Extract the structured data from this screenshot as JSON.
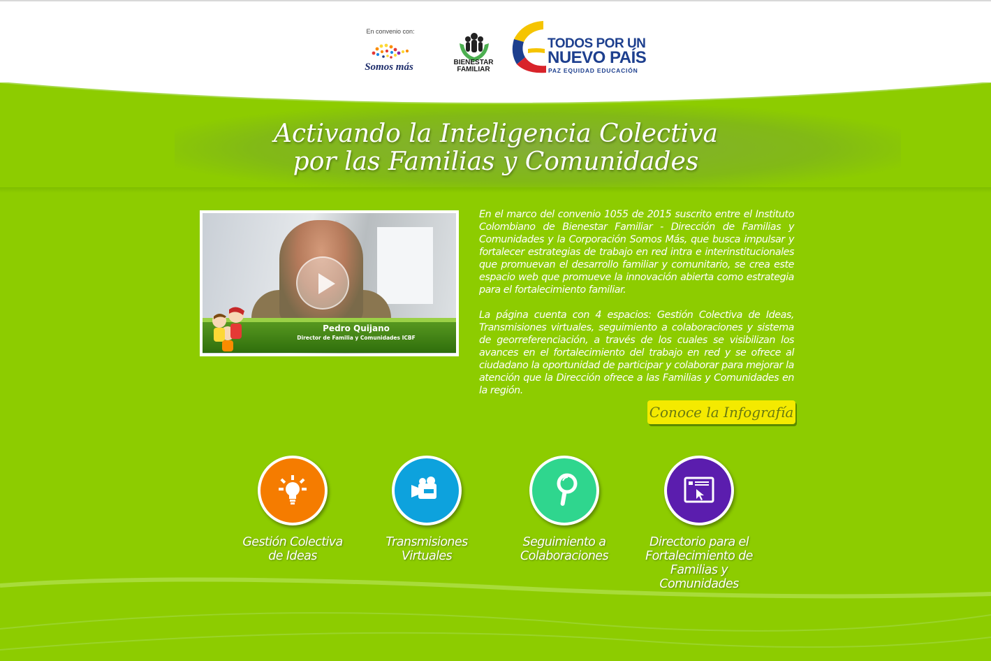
{
  "header": {
    "convenio_label": "En convenio con:",
    "somos_mas_logo": "Somos más",
    "bienestar_logo_line1": "BIENESTAR",
    "bienestar_logo_line2": "FAMILIAR",
    "tpu_line1": "TODOS POR UN",
    "tpu_line2": "NUEVO PAÍS",
    "tpu_tagline": "PAZ   EQUIDAD   EDUCACIÓN"
  },
  "hero": {
    "title_line1": "Activando la Inteligencia Colectiva",
    "title_line2": "por las Familias y Comunidades"
  },
  "video": {
    "speaker_name": "Pedro Quijano",
    "speaker_role": "Director de Familia y Comunidades ICBF",
    "play_icon": "play-icon"
  },
  "intro": {
    "paragraph1": "En el marco del convenio 1055 de 2015 suscrito entre el Instituto Colombiano de Bienestar Familiar - Dirección de Familias y Comunidades y la Corporación Somos Más, que busca impulsar y fortalecer estrategias de trabajo en red intra e interinstitucionales que promuevan el desarrollo familiar y comunitario, se crea este espacio web que promueve la innovación abierta como estrategia para el fortalecimiento familiar.",
    "paragraph2": "La página cuenta con 4 espacios: Gestión Colectiva de Ideas, Transmisiones virtuales, seguimiento a colaboraciones y sistema de georreferenciación, a través de los cuales se visibilizan los avances en el fortalecimiento del trabajo en red y se ofrece al ciudadano la oportunidad de participar y colaborar  para mejorar la atención que la Dirección ofrece a las Familias y Comunidades en la región.",
    "infographic_button": "Conoce la Infografía"
  },
  "sections": [
    {
      "line1": "Gestión Colectiva",
      "line2": "de Ideas",
      "line3": "",
      "icon": "lightbulb-icon",
      "color": "#f57c00"
    },
    {
      "line1": "Transmisiones",
      "line2": "Virtuales",
      "line3": "",
      "icon": "video-camera-icon",
      "color": "#0da2dd"
    },
    {
      "line1": "Seguimiento a",
      "line2": "Colaboraciones",
      "line3": "",
      "icon": "magnifier-icon",
      "color": "#2fd68e"
    },
    {
      "line1": "Directorio para el",
      "line2": "Fortalecimiento de",
      "line3": "Familias y Comunidades",
      "icon": "web-directory-icon",
      "color": "#5b1dae"
    }
  ],
  "colors": {
    "background": "#8dcc00",
    "button": "#f4ea00"
  }
}
